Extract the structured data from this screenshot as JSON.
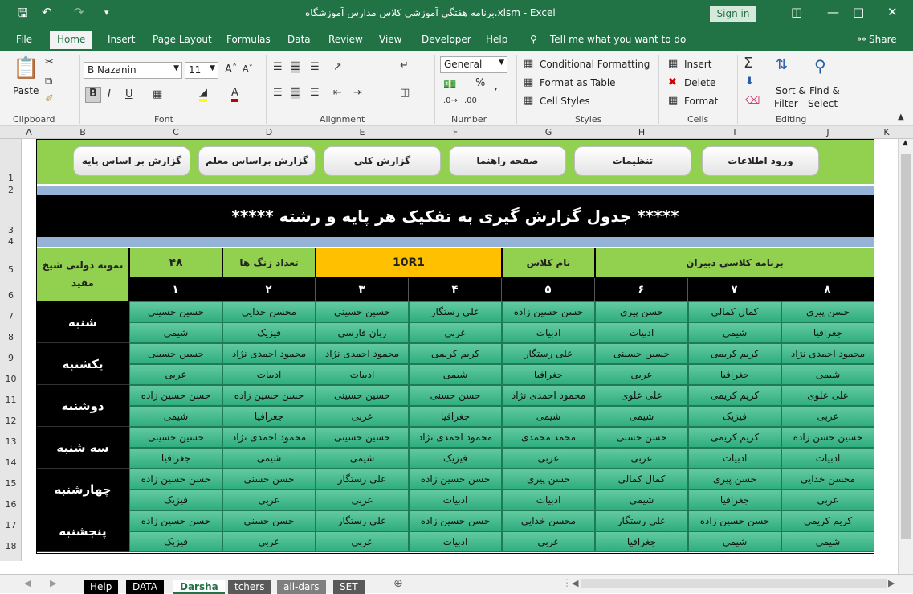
{
  "window": {
    "title": "برنامه هفتگی آموزشی کلاس مدارس آموزشگاه.xlsm  -  Excel",
    "sign_in": "Sign in"
  },
  "ribbon_tabs": [
    "File",
    "Home",
    "Insert",
    "Page Layout",
    "Formulas",
    "Data",
    "Review",
    "View",
    "Developer",
    "Help"
  ],
  "tell_me": "Tell me what you want to do",
  "share": "Share",
  "ribbon": {
    "paste": "Paste",
    "font_name": "B Nazanin",
    "font_size": "11",
    "number_format": "General",
    "conditional_formatting": "Conditional Formatting",
    "format_as_table": "Format as Table",
    "cell_styles": "Cell Styles",
    "insert": "Insert",
    "delete": "Delete",
    "format": "Format",
    "sort_filter_1": "Sort &",
    "sort_filter_2": "Filter",
    "find_select_1": "Find &",
    "find_select_2": "Select",
    "groups": {
      "clipboard": "Clipboard",
      "font": "Font",
      "alignment": "Alignment",
      "number": "Number",
      "styles": "Styles",
      "cells": "Cells",
      "editing": "Editing"
    }
  },
  "columns": [
    "A",
    "B",
    "C",
    "D",
    "E",
    "F",
    "G",
    "H",
    "I",
    "J",
    "K"
  ],
  "rows": [
    "1",
    "2",
    "3",
    "4",
    "5",
    "6",
    "7",
    "8",
    "9",
    "10",
    "11",
    "12",
    "13",
    "14",
    "15",
    "16",
    "17",
    "18"
  ],
  "nav_buttons": [
    "ورود اطلاعات",
    "تنظیمات",
    "صفحه راهنما",
    "گزارش کلی",
    "گزارش براساس معلم",
    "گزارش بر اساس پایه"
  ],
  "report_title": "***** جدول گزارش گیری به تفکیک هر پایه و رشته *****",
  "header": {
    "school": "نمونه دولتی شیخ مفید",
    "periods_count": "۴۸",
    "periods_label": "تعداد زنگ ها",
    "class_code": "10R1",
    "class_label": "نام کلاس",
    "program_label": "برنامه کلاسی دبیران"
  },
  "period_numbers": [
    "۱",
    "۲",
    "۳",
    "۴",
    "۵",
    "۶",
    "۷",
    "۸"
  ],
  "schedule": [
    {
      "day": "شنبه",
      "teachers": [
        "حسن پیری",
        "کمال کمالی",
        "حسن پیری",
        "حسن حسین زاده",
        "علی رستگار",
        "حسین حسینی",
        "محسن خدایی",
        "حسین حسینی"
      ],
      "subjects": [
        "جغرافیا",
        "شیمی",
        "ادبیات",
        "ادبیات",
        "عربی",
        "زبان فارسی",
        "فیزیک",
        "شیمی"
      ]
    },
    {
      "day": "یکشنبه",
      "teachers": [
        "محمود احمدی نژاد",
        "کریم کریمی",
        "حسین حسینی",
        "علی رستگار",
        "کریم کریمی",
        "محمود احمدی نژاد",
        "محمود احمدی نژاد",
        "حسین حسینی"
      ],
      "subjects": [
        "شیمی",
        "جغرافیا",
        "عربی",
        "جغرافیا",
        "شیمی",
        "ادبیات",
        "ادبیات",
        "عربی"
      ]
    },
    {
      "day": "دوشنبه",
      "teachers": [
        "علی علوی",
        "کریم کریمی",
        "علی علوی",
        "محمود احمدی نژاد",
        "حسن حسنی",
        "حسین حسینی",
        "حسن حسین زاده",
        "حسن حسین زاده"
      ],
      "subjects": [
        "عربی",
        "فیزیک",
        "شیمی",
        "شیمی",
        "جغرافیا",
        "عربی",
        "جغرافیا",
        "شیمی"
      ]
    },
    {
      "day": "سه شنبه",
      "teachers": [
        "حسین حسن زاده",
        "کریم کریمی",
        "حسن حسنی",
        "محمد محمدی",
        "محمود احمدی نژاد",
        "حسین حسینی",
        "محمود احمدی نژاد",
        "حسین حسینی"
      ],
      "subjects": [
        "ادبیات",
        "ادبیات",
        "عربی",
        "عربی",
        "فیزیک",
        "شیمی",
        "شیمی",
        "جغرافیا"
      ]
    },
    {
      "day": "چهارشنبه",
      "teachers": [
        "محسن خدایی",
        "حسن پیری",
        "کمال کمالی",
        "حسن پیری",
        "حسن حسین زاده",
        "علی رستگار",
        "حسن حسنی",
        "حسن حسین زاده"
      ],
      "subjects": [
        "عربی",
        "جغرافیا",
        "شیمی",
        "ادبیات",
        "ادبیات",
        "عربی",
        "عربی",
        "فیزیک"
      ]
    },
    {
      "day": "پنجشنبه",
      "teachers": [
        "کریم کریمی",
        "حسن حسین زاده",
        "علی رستگار",
        "محسن خدایی",
        "حسن حسین زاده",
        "علی رستگار",
        "حسن حسنی",
        "حسن حسین زاده"
      ],
      "subjects": [
        "شیمی",
        "شیمی",
        "جغرافیا",
        "عربی",
        "ادبیات",
        "عربی",
        "عربی",
        "فیزیک"
      ]
    }
  ],
  "sheet_tabs": [
    "Help",
    "DATA",
    "Darsha",
    "tchers",
    "all-dars",
    "SET"
  ],
  "active_sheet": "Darsha",
  "colors": {
    "excel_green": "#217346",
    "light_green": "#92d050",
    "gold": "#ffc000",
    "cell_green": "#3cb98a"
  }
}
